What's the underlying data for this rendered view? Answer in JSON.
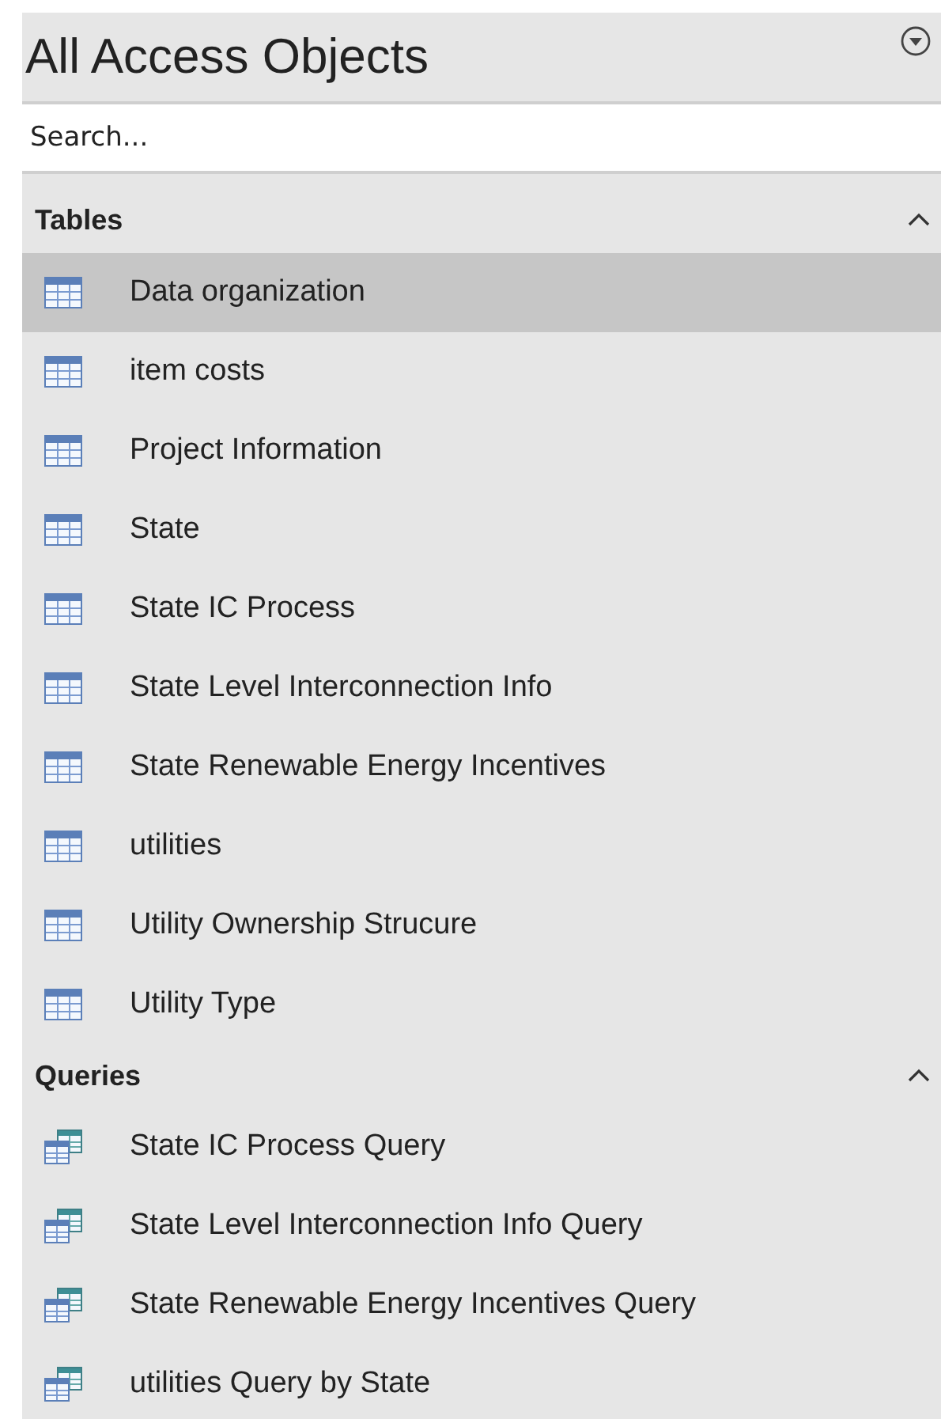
{
  "pane": {
    "title": "All Access Objects"
  },
  "search": {
    "placeholder": "Search..."
  },
  "groups": [
    {
      "title": "Tables",
      "expanded": true,
      "items": [
        {
          "kind": "table",
          "label": "Data organization",
          "selected": true
        },
        {
          "kind": "table",
          "label": "item costs",
          "selected": false
        },
        {
          "kind": "table",
          "label": "Project Information",
          "selected": false
        },
        {
          "kind": "table",
          "label": "State",
          "selected": false
        },
        {
          "kind": "table",
          "label": "State IC Process",
          "selected": false
        },
        {
          "kind": "table",
          "label": "State Level Interconnection Info",
          "selected": false
        },
        {
          "kind": "table",
          "label": "State Renewable Energy Incentives",
          "selected": false
        },
        {
          "kind": "table",
          "label": "utilities",
          "selected": false
        },
        {
          "kind": "table",
          "label": "Utility Ownership Strucure",
          "selected": false
        },
        {
          "kind": "table",
          "label": "Utility Type",
          "selected": false
        }
      ]
    },
    {
      "title": "Queries",
      "expanded": true,
      "items": [
        {
          "kind": "query",
          "label": "State IC Process Query",
          "selected": false
        },
        {
          "kind": "query",
          "label": "State Level Interconnection Info Query",
          "selected": false
        },
        {
          "kind": "query",
          "label": "State Renewable Energy Incentives Query",
          "selected": false
        },
        {
          "kind": "query",
          "label": "utilities Query by State",
          "selected": false
        }
      ]
    }
  ]
}
